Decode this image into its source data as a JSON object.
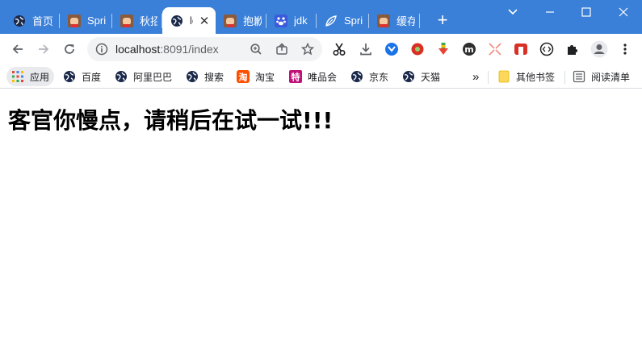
{
  "tabs": [
    {
      "label": "首页",
      "icon": "globe-icon"
    },
    {
      "label": "Spri",
      "icon": "avatar-icon"
    },
    {
      "label": "秋招",
      "icon": "avatar-icon"
    },
    {
      "label": "lo",
      "icon": "globe-icon",
      "active": true
    },
    {
      "label": "抱歉",
      "icon": "avatar-icon"
    },
    {
      "label": "jdk",
      "icon": "paw-icon"
    },
    {
      "label": "Spri",
      "icon": "leaf-icon"
    },
    {
      "label": "缓存",
      "icon": "avatar-icon"
    }
  ],
  "omnibox": {
    "host": "localhost",
    "path": ":8091/index"
  },
  "bookmarks": {
    "apps": "应用",
    "items": [
      "百度",
      "阿里巴巴",
      "搜索",
      "淘宝",
      "唯品会",
      "京东",
      "天猫"
    ],
    "overflow": "»",
    "other": "其他书签",
    "reading_list": "阅读清单"
  },
  "page": {
    "heading": "客官你慢点，请稍后在试一试!!!"
  },
  "colors": {
    "tabstrip": "#3a7fd8",
    "accent": "#1a73e8"
  }
}
